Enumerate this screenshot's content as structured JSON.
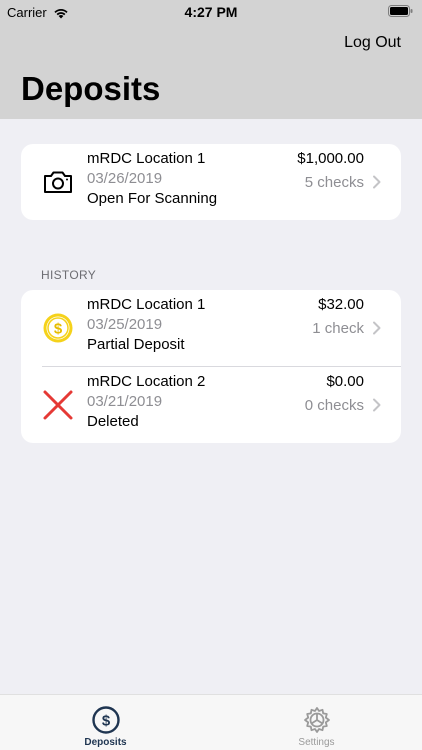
{
  "status_bar": {
    "carrier": "Carrier",
    "time": "4:27 PM"
  },
  "header": {
    "logout_label": "Log Out",
    "title": "Deposits"
  },
  "current": {
    "location": "mRDC Location 1",
    "date": "03/26/2019",
    "status": "Open For Scanning",
    "amount": "$1,000.00",
    "count": "5 checks",
    "icon": "camera-icon"
  },
  "history": {
    "section_label": "HISTORY",
    "items": [
      {
        "location": "mRDC Location 1",
        "date": "03/25/2019",
        "status": "Partial Deposit",
        "amount": "$32.00",
        "count": "1 check",
        "icon": "dollar-coin-icon"
      },
      {
        "location": "mRDC Location 2",
        "date": "03/21/2019",
        "status": "Deleted",
        "amount": "$0.00",
        "count": "0 checks",
        "icon": "red-x-icon"
      }
    ]
  },
  "tabs": [
    {
      "label": "Deposits",
      "icon": "dollar-circle-icon",
      "active": true
    },
    {
      "label": "Settings",
      "icon": "gear-icon",
      "active": false
    }
  ],
  "colors": {
    "header_bg": "#d3d3d3",
    "page_bg": "#efeff4",
    "coin_yellow": "#f5d21a",
    "delete_red": "#e53935",
    "tab_active": "#1f3551"
  }
}
